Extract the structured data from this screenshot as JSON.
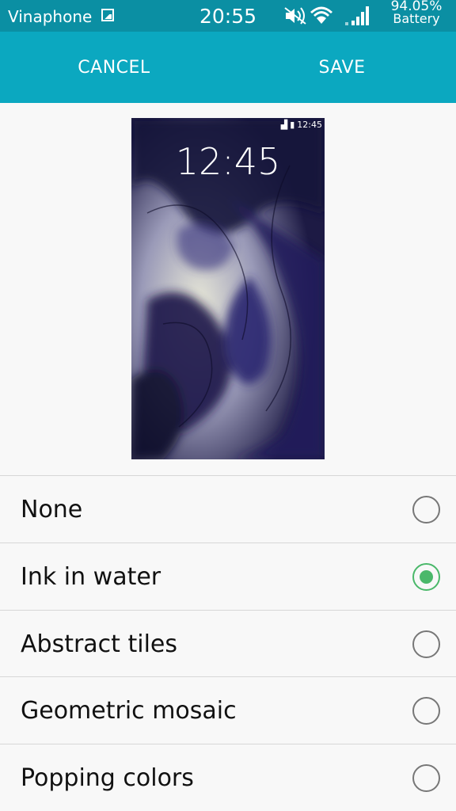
{
  "status_bar": {
    "carrier": "Vinaphone",
    "time": "20:55",
    "battery_percent": "94.05%",
    "battery_label": "Battery",
    "icons": [
      "gallery-icon",
      "mute-icon",
      "wifi-icon",
      "signal-icon"
    ]
  },
  "action_bar": {
    "cancel_label": "CANCEL",
    "save_label": "SAVE"
  },
  "preview": {
    "status_time": "12:45",
    "clock": "12:45"
  },
  "options": [
    {
      "label": "None",
      "selected": false
    },
    {
      "label": "Ink in water",
      "selected": true
    },
    {
      "label": "Abstract tiles",
      "selected": false
    },
    {
      "label": "Geometric mosaic",
      "selected": false
    },
    {
      "label": "Popping colors",
      "selected": false
    }
  ],
  "colors": {
    "status_bar": "#0b8fa3",
    "action_bar": "#0ba8c0",
    "radio_selected": "#4ab86a"
  }
}
